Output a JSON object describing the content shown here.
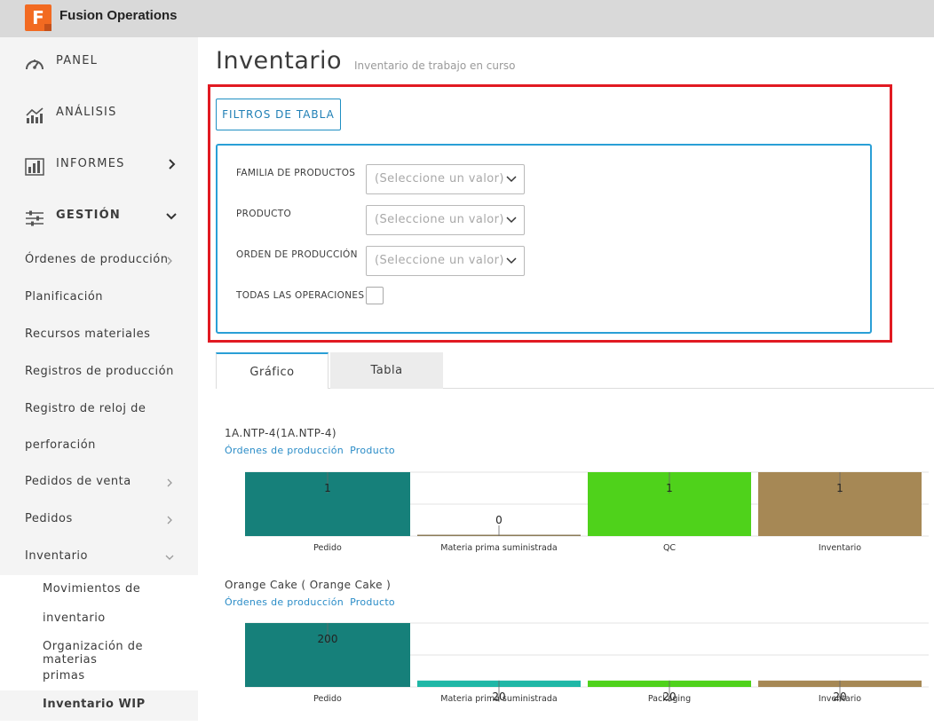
{
  "app": {
    "logo_letter": "F",
    "name": "Fusion Operations"
  },
  "sidebar": {
    "top_items": [
      {
        "label": "PANEL",
        "icon": "gauge-icon"
      },
      {
        "label": "ANÁLISIS",
        "icon": "analytics-chart-icon"
      },
      {
        "label": "INFORMES",
        "icon": "bar-report-icon"
      },
      {
        "label": "GESTIÓN",
        "icon": "sliders-icon"
      }
    ],
    "sub_items": [
      {
        "label": "Órdenes de producción"
      },
      {
        "label": "Planificación"
      },
      {
        "label": "Recursos materiales"
      },
      {
        "label": "Registros de producción"
      },
      {
        "label": "Registro de reloj de"
      },
      {
        "label": "perforación"
      },
      {
        "label": "Pedidos de venta"
      },
      {
        "label": "Pedidos"
      },
      {
        "label": "Inventario"
      }
    ],
    "inventory_items": [
      {
        "label": "Movimientos de"
      },
      {
        "label": "inventario"
      },
      {
        "label": "Organización de materias"
      },
      {
        "label": "primas"
      },
      {
        "label": "Inventario WIP"
      }
    ]
  },
  "page": {
    "title": "Inventario",
    "subtitle": "Inventario de trabajo en curso"
  },
  "filters": {
    "button_label": "FILTROS DE TABLA",
    "fields": [
      {
        "label": "FAMILIA DE PRODUCTOS",
        "placeholder": "(Seleccione un valor)"
      },
      {
        "label": "PRODUCTO",
        "placeholder": "(Seleccione un valor)"
      },
      {
        "label": "ORDEN DE PRODUCCIÓN",
        "placeholder": "(Seleccione un valor)"
      }
    ],
    "all_ops_label": "TODAS LAS OPERACIONES"
  },
  "tabs": [
    {
      "label": "Gráfico",
      "active": true
    },
    {
      "label": "Tabla",
      "active": false
    }
  ],
  "charts_meta": [
    {
      "title": "1A.NTP-4(1A.NTP-4)",
      "links": [
        "Órdenes de producción",
        "Producto"
      ]
    },
    {
      "title": "Orange Cake ( Orange Cake )",
      "links": [
        "Órdenes de producción",
        "Producto"
      ]
    }
  ],
  "chart_data": [
    {
      "type": "bar",
      "title": "1A.NTP-4(1A.NTP-4)",
      "categories": [
        "Pedido",
        "Materia prima suministrada",
        "QC",
        "Inventario"
      ],
      "values": [
        1,
        0,
        1,
        1
      ],
      "ylim": [
        0,
        1
      ],
      "colors": [
        "#16807a",
        "#8a7a57",
        "#4fd21b",
        "#a68855"
      ],
      "grid": true
    },
    {
      "type": "bar",
      "title": "Orange Cake ( Orange Cake )",
      "categories": [
        "Pedido",
        "Materia prima suministrada",
        "Packaging",
        "Inventario"
      ],
      "values": [
        200,
        20,
        20,
        20
      ],
      "ylim": [
        0,
        200
      ],
      "colors": [
        "#16807a",
        "#1fb7a6",
        "#4fd21b",
        "#a68855"
      ],
      "grid": true
    }
  ]
}
